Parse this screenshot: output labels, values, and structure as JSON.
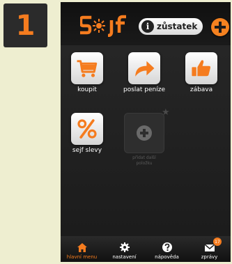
{
  "step": {
    "number": "1"
  },
  "header": {
    "balance_label": "zůstatek",
    "logo_text": "sejf"
  },
  "tiles": [
    {
      "label": "koupit",
      "icon": "cart-icon"
    },
    {
      "label": "poslat peníze",
      "icon": "arrow-right-icon"
    },
    {
      "label": "zábava",
      "icon": "thumbs-up-icon"
    },
    {
      "label": "sejf slevy",
      "icon": "percent-icon"
    }
  ],
  "empty_slot": {
    "label_line1": "přidat další",
    "label_line2": "položku",
    "icon": "plus-icon"
  },
  "bottom_nav": [
    {
      "label": "hlavní menu",
      "icon": "home-icon",
      "active": true
    },
    {
      "label": "nastavení",
      "icon": "gear-icon"
    },
    {
      "label": "nápověda",
      "icon": "help-icon"
    },
    {
      "label": "zprávy",
      "icon": "envelope-icon",
      "badge": "17"
    }
  ],
  "colors": {
    "accent": "#f57c1f",
    "background": "#eeeed0",
    "phone_bg": "#1d1d1d"
  }
}
